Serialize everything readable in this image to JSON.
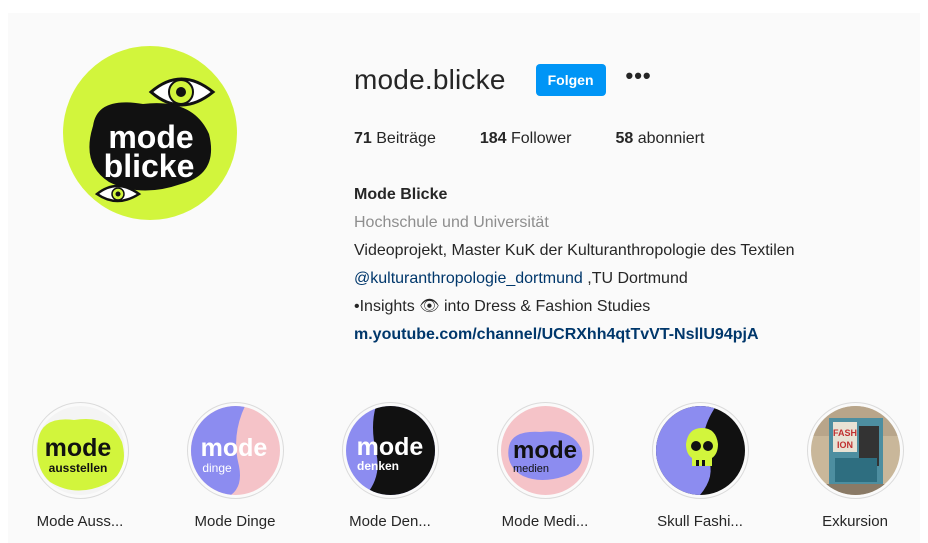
{
  "profile": {
    "username": "mode.blicke",
    "follow_label": "Folgen",
    "more_label": "•••",
    "avatar_text_line1": "mode",
    "avatar_text_line2": "blicke"
  },
  "stats": {
    "posts_count": "71",
    "posts_label": "Beiträge",
    "followers_count": "184",
    "followers_label": "Follower",
    "following_count": "58",
    "following_label": "abonniert"
  },
  "bio": {
    "name": "Mode Blicke",
    "category": "Hochschule und Universität",
    "line1": "Videoprojekt, Master KuK der Kulturanthropologie des Textilen",
    "mention": "@kulturanthropologie_dortmund",
    "mention_suffix": " ,TU Dortmund",
    "line3": "•Insights 👁 into Dress & Fashion Studies",
    "link": "m.youtube.com/channel/UCRXhh4qtTvVT-NsllU94pjA"
  },
  "highlights": [
    {
      "label": "Mode Auss...",
      "big": "mode",
      "small": "ausstellen"
    },
    {
      "label": "Mode Dinge",
      "big": "mode",
      "small": "dinge"
    },
    {
      "label": "Mode Den...",
      "big": "mode",
      "small": "denken"
    },
    {
      "label": "Mode Medi...",
      "big": "mode",
      "small": "medien"
    },
    {
      "label": "Skull Fashi..."
    },
    {
      "label": "Exkursion"
    }
  ],
  "colors": {
    "accent_blue": "#0095f6",
    "lime": "#d2f53c",
    "periwinkle": "#8c8cf0",
    "pink": "#f5c3c8",
    "link": "#00376b"
  }
}
